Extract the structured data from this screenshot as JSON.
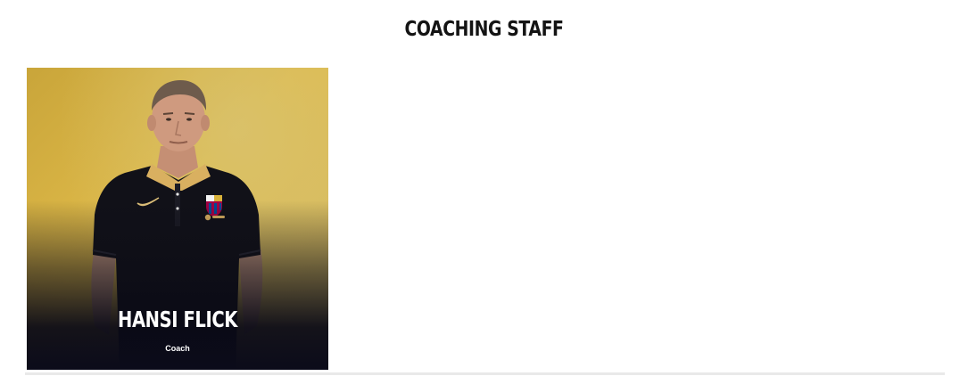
{
  "section": {
    "title": "COACHING STAFF"
  },
  "staff": [
    {
      "name": "HANSI FLICK",
      "role": "Coach",
      "icons": [
        "nike-swoosh-icon",
        "club-crest-icon",
        "sponsor-logo-icon"
      ]
    }
  ],
  "colors": {
    "card_background": "#d9b547",
    "shirt": "#111118",
    "collar": "#d9b060",
    "title_text": "#141414",
    "name_text": "#ffffff"
  }
}
